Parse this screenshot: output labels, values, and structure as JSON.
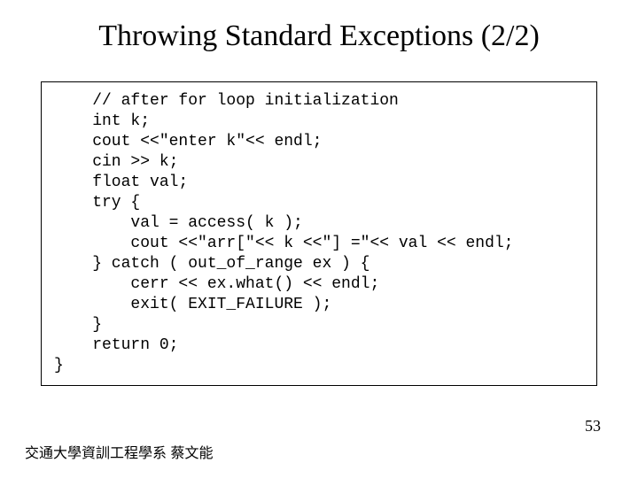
{
  "title": "Throwing Standard Exceptions (2/2)",
  "code": {
    "l1": "    // after for loop initialization",
    "l2": "    int k;",
    "l3": "    cout <<\"enter k\"<< endl;",
    "l4": "    cin >> k;",
    "l5": "    float val;",
    "l6": "    try {",
    "l7": "        val = access( k );",
    "l8": "        cout <<\"arr[\"<< k <<\"] =\"<< val << endl;",
    "l9": "    } catch ( out_of_range ex ) {",
    "l10": "        cerr << ex.what() << endl;",
    "l11": "        exit( EXIT_FAILURE );",
    "l12": "    }",
    "l13": "    return 0;",
    "l14": "}"
  },
  "footer": "交通大學資訓工程學系 蔡文能",
  "page_number": "53"
}
